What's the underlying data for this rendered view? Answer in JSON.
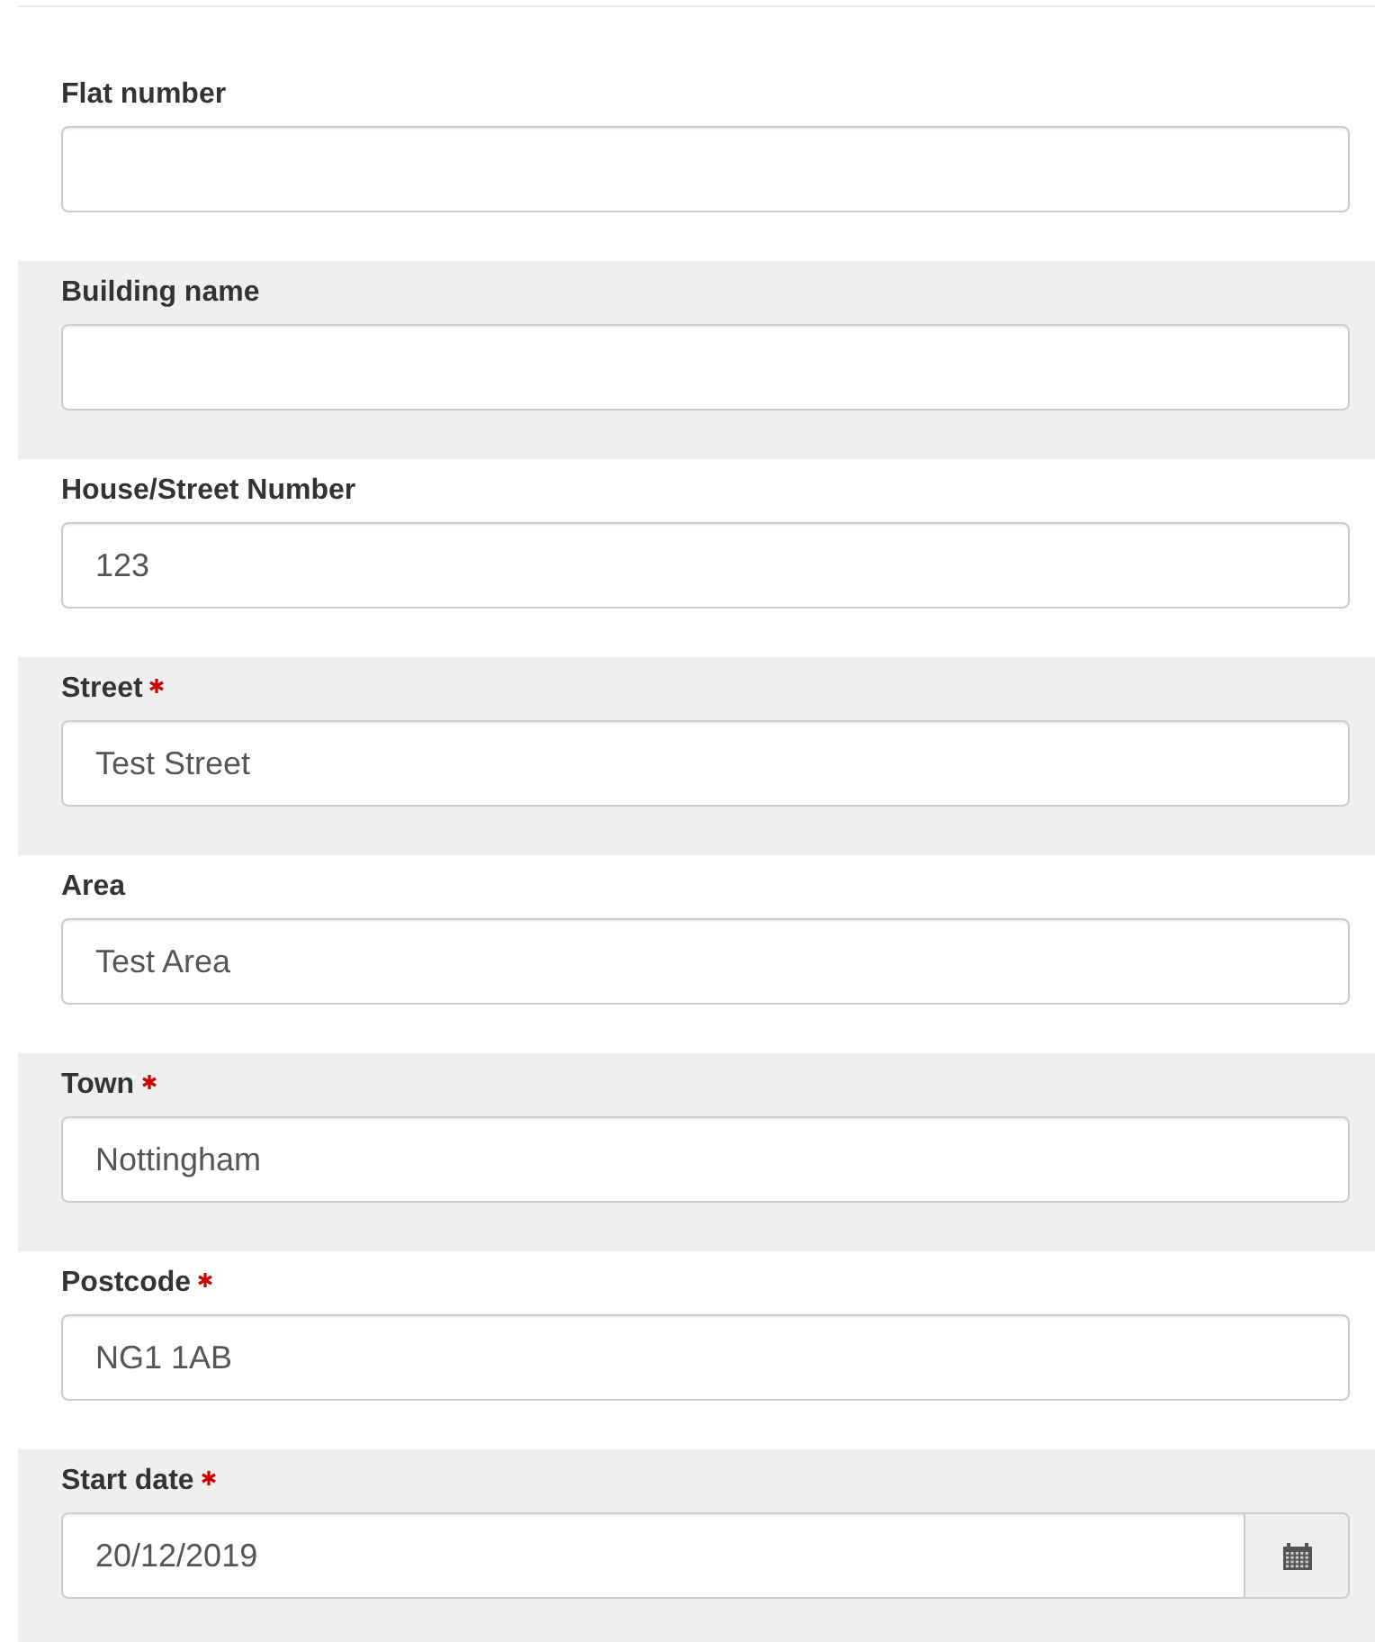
{
  "fields": [
    {
      "label": "Flat number",
      "required": false,
      "kind": "text"
    },
    {
      "label": "Building name",
      "required": false,
      "kind": "text"
    },
    {
      "label": "House/Street Number",
      "required": false,
      "kind": "text",
      "value": "123"
    },
    {
      "label": "Street",
      "required": true,
      "kind": "text",
      "value": "Test Street"
    },
    {
      "label": "Area",
      "required": false,
      "kind": "text",
      "value": "Test Area"
    },
    {
      "label": "Town",
      "required": true,
      "kind": "text",
      "value": "Nottingham"
    },
    {
      "label": "Postcode",
      "required": true,
      "kind": "text",
      "value": "NG1 1AB"
    },
    {
      "label": "Start date",
      "required": true,
      "kind": "date",
      "value": "20/12/2019"
    }
  ]
}
